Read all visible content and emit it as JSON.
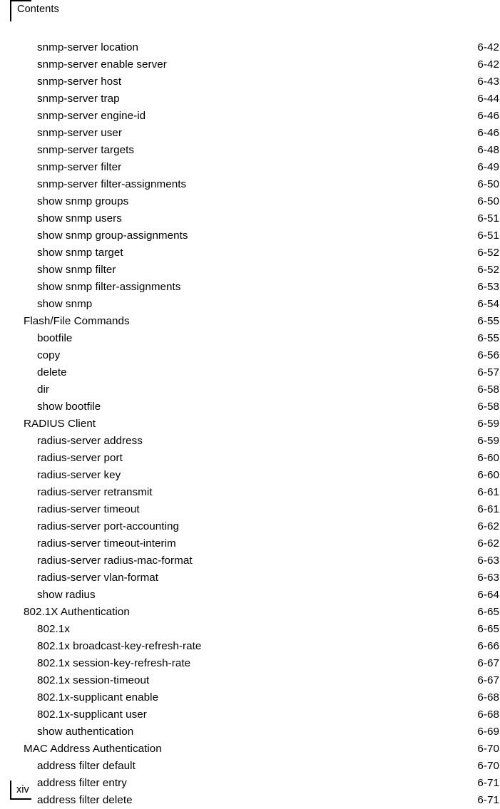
{
  "header": {
    "title": "Contents"
  },
  "footer": {
    "folio": "xiv"
  },
  "toc": {
    "entries": [
      {
        "label": "snmp-server location",
        "page": "6-42",
        "level": 3
      },
      {
        "label": "snmp-server enable server",
        "page": "6-42",
        "level": 3
      },
      {
        "label": "snmp-server host",
        "page": "6-43",
        "level": 3
      },
      {
        "label": "snmp-server trap",
        "page": "6-44",
        "level": 3
      },
      {
        "label": "snmp-server engine-id",
        "page": "6-46",
        "level": 3
      },
      {
        "label": "snmp-server user",
        "page": "6-46",
        "level": 3
      },
      {
        "label": "snmp-server targets",
        "page": "6-48",
        "level": 3
      },
      {
        "label": "snmp-server filter",
        "page": "6-49",
        "level": 3
      },
      {
        "label": "snmp-server filter-assignments",
        "page": "6-50",
        "level": 3
      },
      {
        "label": "show snmp groups",
        "page": "6-50",
        "level": 3
      },
      {
        "label": "show snmp users",
        "page": "6-51",
        "level": 3
      },
      {
        "label": "show snmp group-assignments",
        "page": "6-51",
        "level": 3
      },
      {
        "label": "show snmp target",
        "page": "6-52",
        "level": 3
      },
      {
        "label": "show snmp filter",
        "page": "6-52",
        "level": 3
      },
      {
        "label": "show snmp filter-assignments",
        "page": "6-53",
        "level": 3
      },
      {
        "label": "show snmp",
        "page": "6-54",
        "level": 3
      },
      {
        "label": "Flash/File Commands",
        "page": "6-55",
        "level": 2
      },
      {
        "label": "bootfile",
        "page": "6-55",
        "level": 3
      },
      {
        "label": "copy",
        "page": "6-56",
        "level": 3
      },
      {
        "label": "delete",
        "page": "6-57",
        "level": 3
      },
      {
        "label": "dir",
        "page": "6-58",
        "level": 3
      },
      {
        "label": "show bootfile",
        "page": "6-58",
        "level": 3
      },
      {
        "label": "RADIUS Client",
        "page": "6-59",
        "level": 2
      },
      {
        "label": "radius-server address",
        "page": "6-59",
        "level": 3
      },
      {
        "label": "radius-server port",
        "page": "6-60",
        "level": 3
      },
      {
        "label": "radius-server key",
        "page": "6-60",
        "level": 3
      },
      {
        "label": "radius-server retransmit",
        "page": "6-61",
        "level": 3
      },
      {
        "label": "radius-server timeout",
        "page": "6-61",
        "level": 3
      },
      {
        "label": "radius-server port-accounting",
        "page": "6-62",
        "level": 3
      },
      {
        "label": "radius-server timeout-interim",
        "page": "6-62",
        "level": 3
      },
      {
        "label": "radius-server radius-mac-format",
        "page": "6-63",
        "level": 3
      },
      {
        "label": "radius-server vlan-format",
        "page": "6-63",
        "level": 3
      },
      {
        "label": "show radius",
        "page": "6-64",
        "level": 3
      },
      {
        "label": "802.1X Authentication",
        "page": "6-65",
        "level": 2
      },
      {
        "label": "802.1x",
        "page": "6-65",
        "level": 3
      },
      {
        "label": "802.1x broadcast-key-refresh-rate",
        "page": "6-66",
        "level": 3
      },
      {
        "label": "802.1x session-key-refresh-rate",
        "page": "6-67",
        "level": 3
      },
      {
        "label": "802.1x session-timeout",
        "page": "6-67",
        "level": 3
      },
      {
        "label": "802.1x-supplicant enable",
        "page": "6-68",
        "level": 3
      },
      {
        "label": "802.1x-supplicant user",
        "page": "6-68",
        "level": 3
      },
      {
        "label": "show authentication",
        "page": "6-69",
        "level": 3
      },
      {
        "label": "MAC Address Authentication",
        "page": "6-70",
        "level": 2
      },
      {
        "label": "address filter default",
        "page": "6-70",
        "level": 3
      },
      {
        "label": "address filter entry",
        "page": "6-71",
        "level": 3
      },
      {
        "label": "address filter delete",
        "page": "6-71",
        "level": 3
      }
    ]
  }
}
